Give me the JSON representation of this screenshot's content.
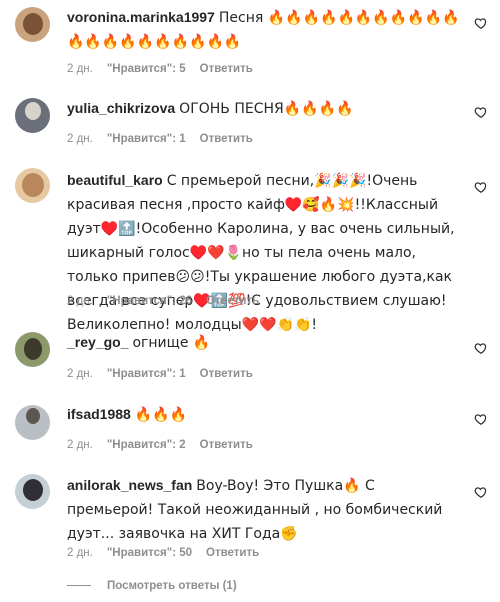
{
  "comments": [
    {
      "username": "voronina.marinka1997",
      "text": "Песня 🔥🔥🔥🔥🔥🔥🔥🔥🔥🔥🔥🔥🔥🔥🔥🔥🔥🔥🔥🔥🔥",
      "time": "2 дн.",
      "likes": "\"Нравится\": 5",
      "reply": "Ответить",
      "avatar_color": "#c9a27e"
    },
    {
      "username": "yulia_chikrizova",
      "text": "ОГОНЬ ПЕСНЯ🔥🔥🔥🔥",
      "time": "2 дн.",
      "likes": "\"Нравится\": 1",
      "reply": "Ответить",
      "avatar_color": "#6a6f7a"
    },
    {
      "username": "beautiful_karo",
      "text": "С премьерой песни,🎉🎉🎉!Очень красивая песня ,просто кайф♥️🥰🔥💥!!Классный дуэт♥️🔝!Особенно Каролина, у вас очень сильный, шикарный голос♥️❤️🌷но ты пела очень мало, только припев😕😕!Ты украшение любого дуэта,как всегда все супер♥️🔝💯!С удовольствием слушаю!Великолепно! молодцы❤️❤️👏👏!",
      "time": "2 дн.",
      "likes": "\"Нравится\": 26",
      "reply": "Ответить",
      "avatar_color": "#e6c9a3"
    },
    {
      "username": "_rey_go_",
      "text": "огнище 🔥",
      "time": "2 дн.",
      "likes": "\"Нравится\": 1",
      "reply": "Ответить",
      "avatar_color": "#8c9a6b"
    },
    {
      "username": "ifsad1988",
      "text": "🔥🔥🔥",
      "time": "2 дн.",
      "likes": "\"Нравится\": 2",
      "reply": "Ответить",
      "avatar_color": "#b9bfc4"
    },
    {
      "username": "anilorak_news_fan",
      "text": "Boy-Boy! Это Пушка🔥 С премьерой! Такой неожиданный , но бомбический дуэт... заявочка на ХИТ Года✊",
      "time": "2 дн.",
      "likes": "\"Нравится\": 50",
      "reply": "Ответить",
      "avatar_color": "#c5cfd6"
    }
  ],
  "view_replies": "Посмотреть ответы (1)",
  "colors": {
    "text": "#262626",
    "meta": "#8e8e8e",
    "background": "#ffffff"
  }
}
